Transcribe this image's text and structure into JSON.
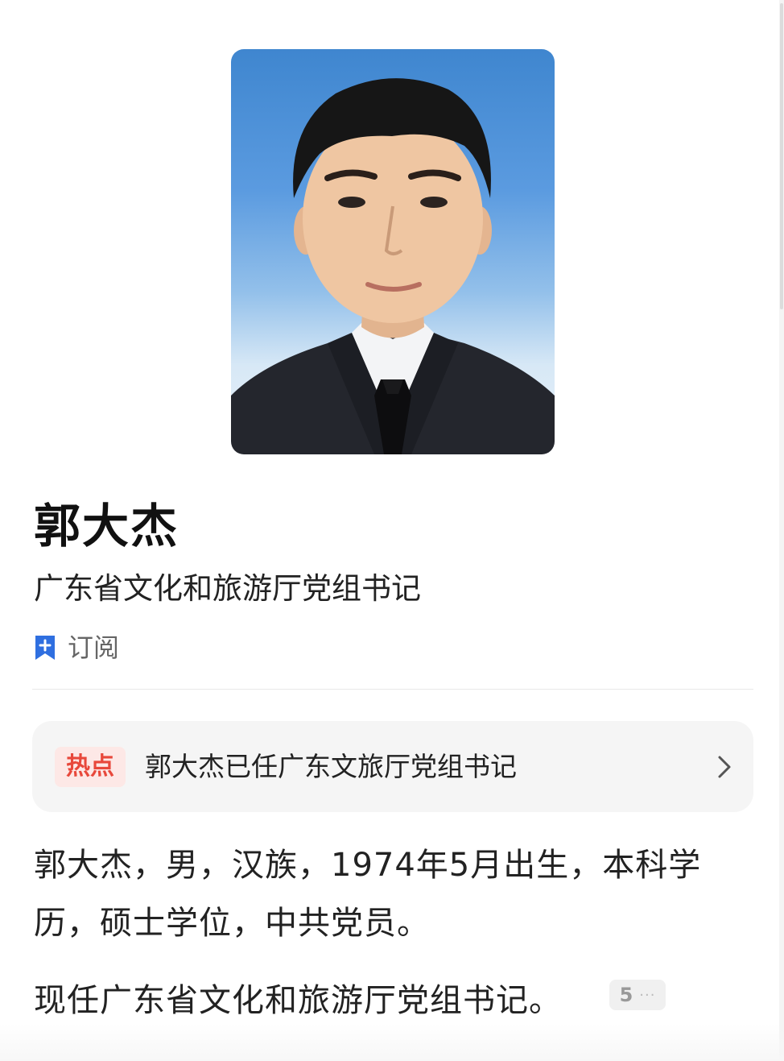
{
  "profile": {
    "name": "郭大杰",
    "title": "广东省文化和旅游厅党组书记",
    "subscribe_label": "订阅",
    "portrait_icon": "portrait-photo"
  },
  "hot": {
    "badge": "热点",
    "headline": "郭大杰已任广东文旅厅党组书记"
  },
  "bio": {
    "line1": "郭大杰，男，汉族，1974年5月出生，本科学历，硕士学位，中共党员。",
    "line2": "现任广东省文化和旅游厅党组书记。",
    "ref_count": "5",
    "ref_more": "···"
  },
  "colors": {
    "accent_blue": "#2f6fe0",
    "hot_red": "#e8483b",
    "hot_badge_bg": "#fde8e6",
    "card_bg": "#f5f5f5"
  }
}
